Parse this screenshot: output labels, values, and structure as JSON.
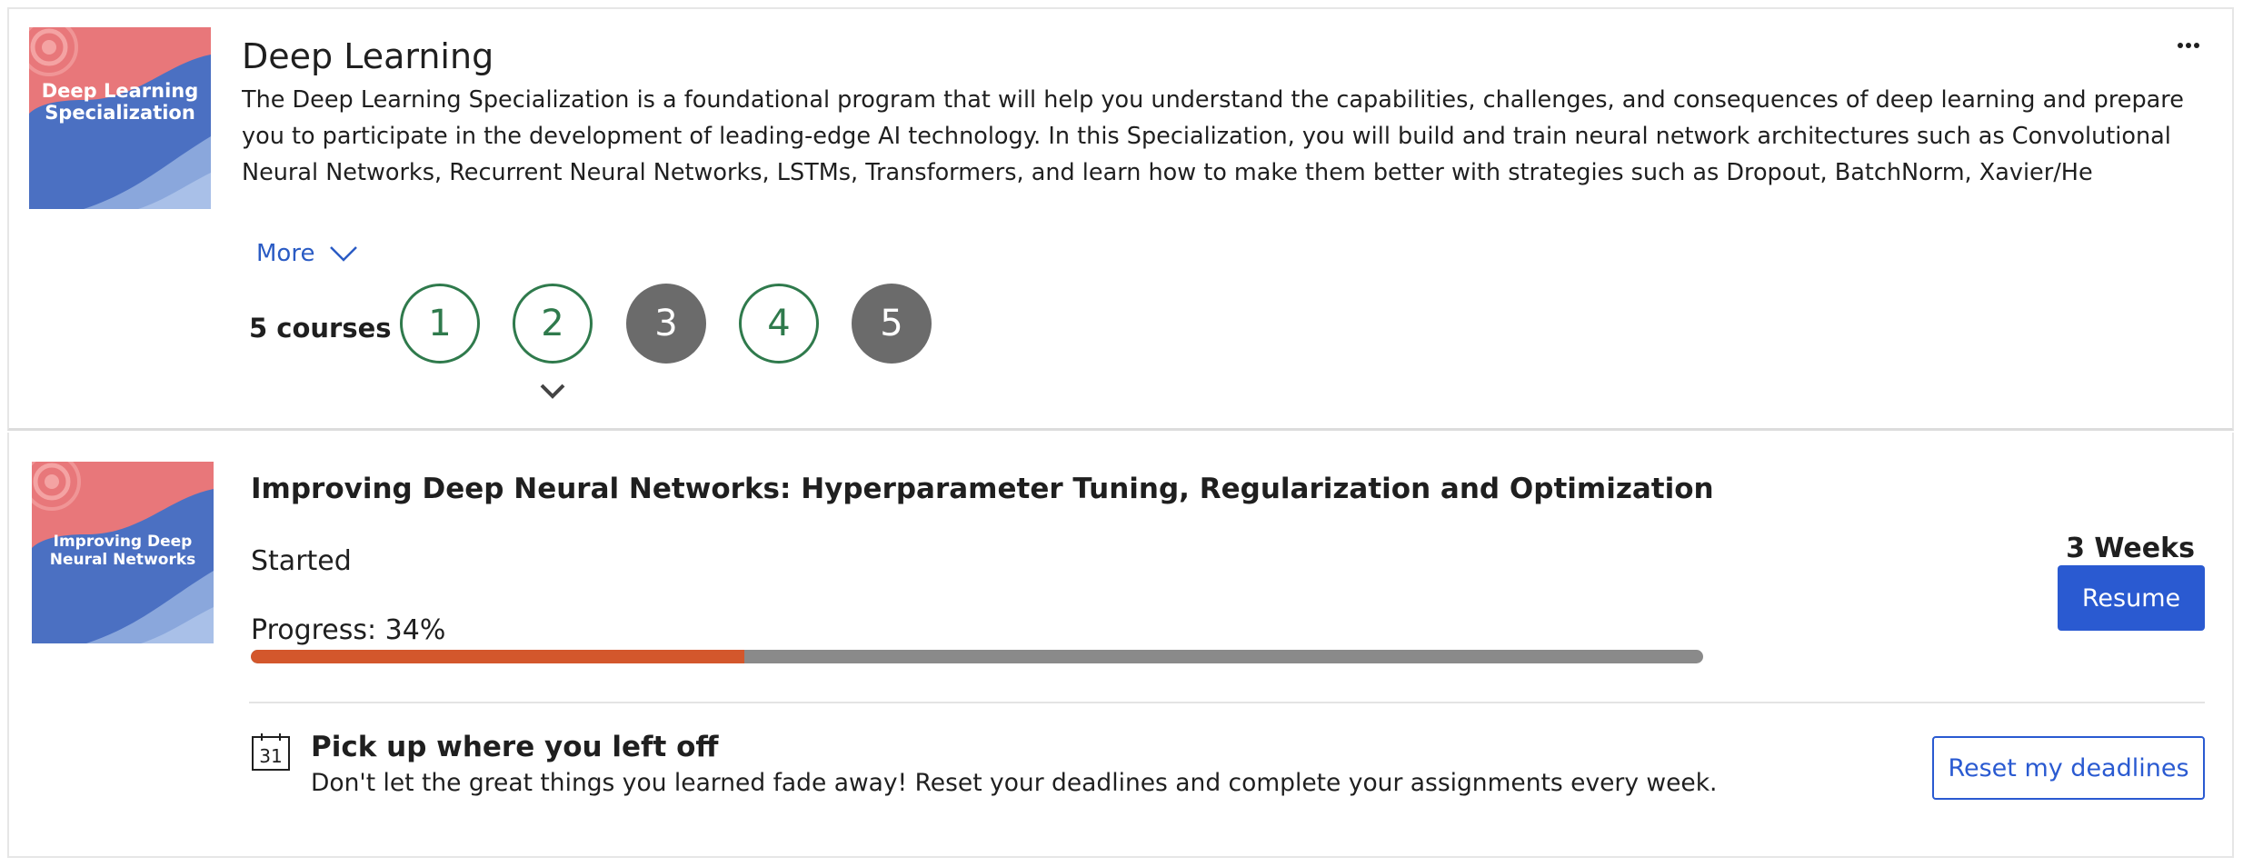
{
  "specialization": {
    "title": "Deep Learning",
    "thumbnail_text": "Deep Learning Specialization",
    "description": "The Deep Learning Specialization is a foundational program that will help you understand the capabilities, challenges, and consequences of deep learning and prepare you to participate in the development of leading-edge AI technology. In this Specialization, you will build and train neural network architectures such as Convolutional Neural Networks, Recurrent Neural Networks, LSTMs, Transformers, and learn how to make them better with strategies such as Dropout, BatchNorm, Xavier/He initialization, and more. Get ready to master theoretical",
    "more_label": "More",
    "menu_icon": "more-horizontal-icon",
    "courses_label": "5 courses",
    "courses": [
      {
        "number": "1",
        "state": "outline"
      },
      {
        "number": "2",
        "state": "outline",
        "selected": true
      },
      {
        "number": "3",
        "state": "filled"
      },
      {
        "number": "4",
        "state": "outline"
      },
      {
        "number": "5",
        "state": "filled"
      }
    ]
  },
  "course": {
    "thumbnail_text": "Improving Deep Neural Networks",
    "title": "Improving Deep Neural Networks: Hyperparameter Tuning, Regularization and Optimization",
    "status": "Started",
    "progress_label": "Progress: 34%",
    "progress_value": 0.34,
    "duration": "3 Weeks",
    "resume_label": "Resume"
  },
  "deadline_notice": {
    "calendar_day": "31",
    "title": "Pick up where you left off",
    "description": "Don't let the great things you learned fade away! Reset your deadlines and complete your assignments every week.",
    "button_label": "Reset my deadlines"
  },
  "colors": {
    "accent_blue": "#2a5ad1",
    "course_green": "#2f7a4c",
    "course_gray": "#6b6b6b",
    "progress_fill": "#d3572c",
    "progress_track": "#8a8a8a"
  }
}
